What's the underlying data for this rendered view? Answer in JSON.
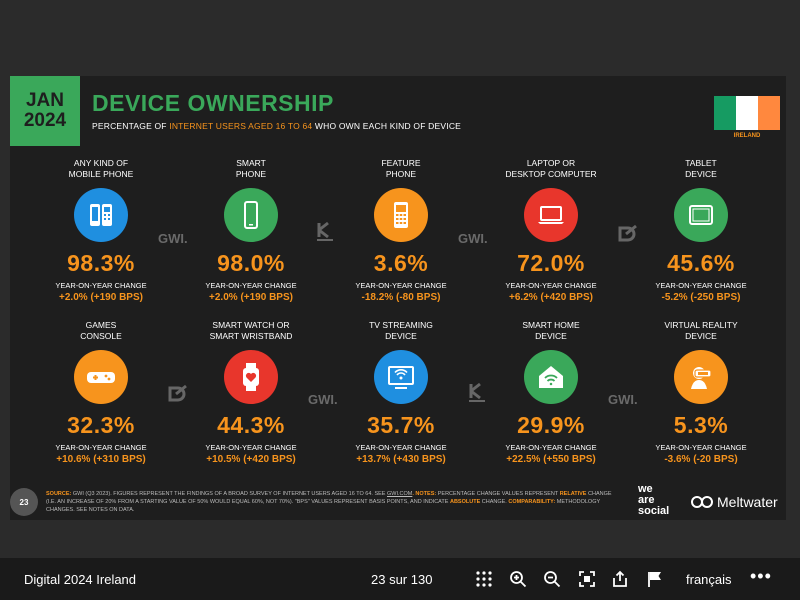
{
  "slide": {
    "date_month": "JAN",
    "date_year": "2024",
    "title": "DEVICE OWNERSHIP",
    "subtitle_pre": "PERCENTAGE OF ",
    "subtitle_highlight": "INTERNET USERS AGED 16 TO 64",
    "subtitle_post": " WHO OWN EACH KIND OF DEVICE",
    "flag_label": "IRELAND",
    "flag_colors": [
      "#169b62",
      "#ffffff",
      "#ff883e"
    ],
    "yoy_label": "YEAR-ON-YEAR CHANGE",
    "devices": [
      {
        "label_1": "ANY KIND OF",
        "label_2": "MOBILE PHONE",
        "value": "98.3%",
        "change": "+2.0% (+190 BPS)",
        "icon": "mobile-phones-icon",
        "color": "#1f8fe0"
      },
      {
        "label_1": "SMART",
        "label_2": "PHONE",
        "value": "98.0%",
        "change": "+2.0% (+190 BPS)",
        "icon": "smartphone-icon",
        "color": "#3aa85a"
      },
      {
        "label_1": "FEATURE",
        "label_2": "PHONE",
        "value": "3.6%",
        "change": "-18.2% (-80 BPS)",
        "icon": "feature-phone-icon",
        "color": "#f7941d"
      },
      {
        "label_1": "LAPTOP OR",
        "label_2": "DESKTOP COMPUTER",
        "value": "72.0%",
        "change": "+6.2% (+420 BPS)",
        "icon": "laptop-icon",
        "color": "#e8362c"
      },
      {
        "label_1": "TABLET",
        "label_2": "DEVICE",
        "value": "45.6%",
        "change": "-5.2% (-250 BPS)",
        "icon": "tablet-icon",
        "color": "#3aa85a"
      },
      {
        "label_1": "GAMES",
        "label_2": "CONSOLE",
        "value": "32.3%",
        "change": "+10.6% (+310 BPS)",
        "icon": "gamepad-icon",
        "color": "#f7941d"
      },
      {
        "label_1": "SMART WATCH OR",
        "label_2": "SMART WRISTBAND",
        "value": "44.3%",
        "change": "+10.5% (+420 BPS)",
        "icon": "smartwatch-icon",
        "color": "#e8362c"
      },
      {
        "label_1": "TV STREAMING",
        "label_2": "DEVICE",
        "value": "35.7%",
        "change": "+13.7% (+430 BPS)",
        "icon": "tv-streaming-icon",
        "color": "#1f8fe0"
      },
      {
        "label_1": "SMART HOME",
        "label_2": "DEVICE",
        "value": "29.9%",
        "change": "+22.5% (+550 BPS)",
        "icon": "smart-home-icon",
        "color": "#3aa85a"
      },
      {
        "label_1": "VIRTUAL REALITY",
        "label_2": "DEVICE",
        "value": "5.3%",
        "change": "-3.6% (-20 BPS)",
        "icon": "vr-headset-icon",
        "color": "#f7941d"
      }
    ],
    "watermark_gwi": "GWI.",
    "page_badge": "23",
    "source_k1": "SOURCE:",
    "source_t1": " GWI (Q3 2023). FIGURES REPRESENT THE FINDINGS OF A BROAD SURVEY OF INTERNET USERS AGED 16 TO 64. SEE ",
    "source_link": "GWI.COM",
    "source_k2": ". NOTES:",
    "source_t2": " PERCENTAGE CHANGE VALUES REPRESENT ",
    "source_k3": "RELATIVE",
    "source_t3": " CHANGE (I.E. AN INCREASE OF 20% FROM A STARTING VALUE OF 50% WOULD EQUAL 60%, NOT 70%). \"BPS\" VALUES REPRESENT BASIS POINTS, AND INDICATE ",
    "source_k4": "ABSOLUTE",
    "source_t4": " CHANGE. ",
    "source_k5": "COMPARABILITY:",
    "source_t5": " METHODOLOGY CHANGES. SEE NOTES ON DATA.",
    "brand_1": "we",
    "brand_2": "are",
    "brand_3": "social",
    "brand_meltwater": "Meltwater"
  },
  "viewer": {
    "doc_title": "Digital 2024 Ireland",
    "page_count": "23 sur 130",
    "language": "français",
    "more": "•••",
    "icons": [
      "grid-icon",
      "zoom-in-icon",
      "zoom-out-icon",
      "fullscreen-icon",
      "share-icon",
      "flag-icon"
    ]
  }
}
